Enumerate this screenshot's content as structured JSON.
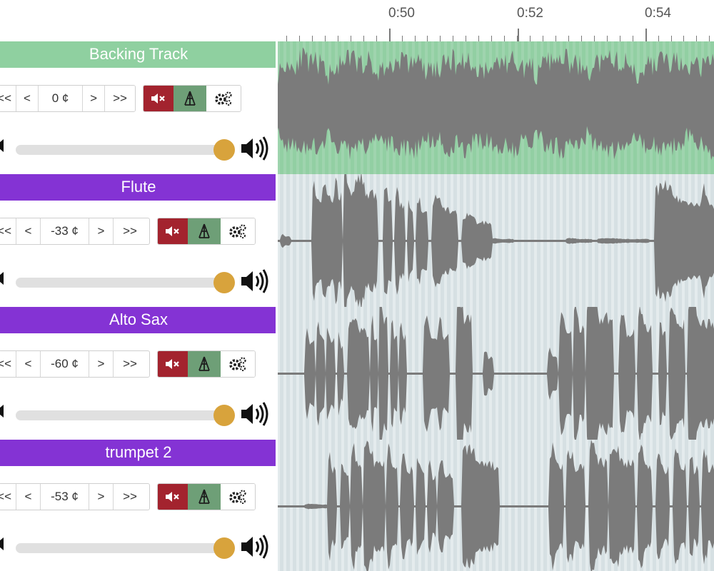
{
  "timeline": {
    "labels": [
      "0:50",
      "0:52",
      "0:54"
    ]
  },
  "colors": {
    "backing_header": "#8fd0a0",
    "instrument_header": "#8433d4",
    "backing_wave_bg": "#92cfa3",
    "instrument_wave_bg": "#d6e0e3",
    "waveform": "#7b7b7b",
    "mute": "#a3232e",
    "solo": "#6e9f77",
    "slider_thumb": "#d8a33c"
  },
  "tracks": [
    {
      "name": "Backing Track",
      "first_btn": "<<",
      "prev_btn": "<",
      "cents": "0 ¢",
      "next_btn": ">",
      "next_next_btn": ">>",
      "volume": 1.0,
      "icons": {
        "mute": "mute-icon",
        "solo": "solo-icon",
        "settings": "gears-icon"
      }
    },
    {
      "name": "Flute",
      "first_btn": "<<",
      "prev_btn": "<",
      "cents": "-33 ¢",
      "next_btn": ">",
      "next_next_btn": ">>",
      "volume": 1.0,
      "icons": {
        "mute": "mute-icon",
        "solo": "solo-icon",
        "settings": "gears-icon"
      }
    },
    {
      "name": "Alto Sax",
      "first_btn": "<<",
      "prev_btn": "<",
      "cents": "-60 ¢",
      "next_btn": ">",
      "next_next_btn": ">>",
      "volume": 1.0,
      "icons": {
        "mute": "mute-icon",
        "solo": "solo-icon",
        "settings": "gears-icon"
      }
    },
    {
      "name": "trumpet 2",
      "first_btn": "<<",
      "prev_btn": "<",
      "cents": "-53 ¢",
      "next_btn": ">",
      "next_next_btn": ">>",
      "volume": 1.0,
      "icons": {
        "mute": "mute-icon",
        "solo": "solo-icon",
        "settings": "gears-icon"
      }
    }
  ]
}
